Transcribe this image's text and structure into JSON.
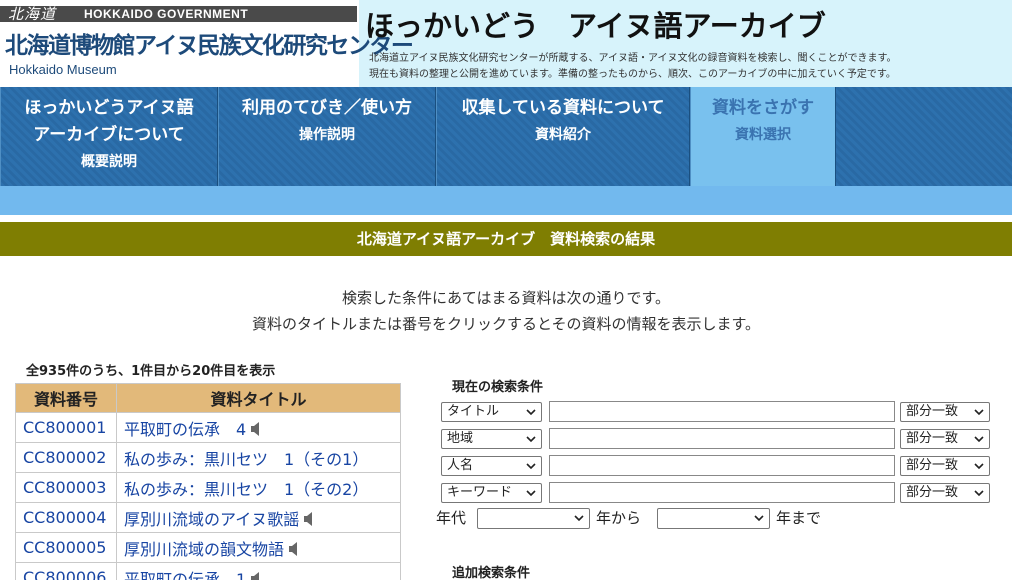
{
  "logo": {
    "brush": "北海道",
    "gov": "HOKKAIDO GOVERNMENT",
    "main": "北海道博物館アイヌ民族文化研究センター",
    "sub": "Hokkaido Museum"
  },
  "site": {
    "title": "ほっかいどう　アイヌ語アーカイブ",
    "desc1": "北海道立アイヌ民族文化研究センターが所蔵する、アイヌ語・アイヌ文化の録音資料を検索し、聞くことができます。",
    "desc2": "現在も資料の整理と公開を進めています。準備の整ったものから、順次、このアーカイブの中に加えていく予定です。"
  },
  "nav": [
    {
      "line1": "ほっかいどうアイヌ語",
      "line2": "アーカイブについて",
      "line3": "概要説明"
    },
    {
      "line1": "利用のてびき／使い方",
      "line2": "操作説明"
    },
    {
      "line1": "収集している資料について",
      "line2": "資料紹介"
    },
    {
      "line1": "資料をさがす",
      "line2": "資料選択"
    }
  ],
  "section_title": "北海道アイヌ語アーカイブ　資料検索の結果",
  "intro": {
    "line1": "検索した条件にあてはまる資料は次の通りです。",
    "line2": "資料のタイトルまたは番号をクリックするとその資料の情報を表示します。"
  },
  "results": {
    "count_text": "全935件のうち、1件目から20件目を表示",
    "headers": [
      "資料番号",
      "資料タイトル"
    ],
    "rows": [
      {
        "id": "CC800001",
        "title": "平取町の伝承　4"
      },
      {
        "id": "CC800002",
        "title": "私の歩み：黒川セツ　1（その1）"
      },
      {
        "id": "CC800003",
        "title": "私の歩み：黒川セツ　1（その2）"
      },
      {
        "id": "CC800004",
        "title": "厚別川流域のアイヌ歌謡"
      },
      {
        "id": "CC800005",
        "title": "厚別川流域の韻文物語"
      },
      {
        "id": "CC800006",
        "title": "平取町の伝承　1"
      }
    ],
    "audio_icon": "speaker-icon"
  },
  "search": {
    "current_label": "現在の検索条件",
    "fields": [
      {
        "field": "タイトル",
        "match": "部分一致",
        "value": ""
      },
      {
        "field": "地域",
        "match": "部分一致",
        "value": ""
      },
      {
        "field": "人名",
        "match": "部分一致",
        "value": ""
      },
      {
        "field": "キーワード",
        "match": "部分一致",
        "value": ""
      }
    ],
    "year_label": "年代",
    "year_from_label": "年から",
    "year_to_label": "年まで",
    "year_from": "",
    "year_to": "",
    "additional_label": "追加検索条件"
  },
  "colors": {
    "nav_blue": "#2d71ae",
    "nav_active": "#79c1ee",
    "section_bar": "#7f7e02",
    "table_header": "#e2b97a",
    "link": "#1845a3"
  }
}
